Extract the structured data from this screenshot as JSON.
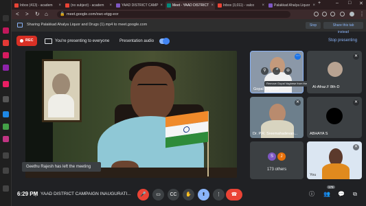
{
  "browser": {
    "tabs": [
      {
        "label": "Inbox (413) - academ",
        "fav_color": "#ea4335",
        "active": false
      },
      {
        "label": "(no subject) - academ",
        "fav_color": "#ea4335",
        "active": false
      },
      {
        "label": "YAAD DISTRICT CAMP",
        "fav_color": "#7e57c2",
        "active": false
      },
      {
        "label": "Meet - YAAD DISTRICT",
        "fav_color": "#00897b",
        "active": true
      },
      {
        "label": "Inbox (3,011) - valco",
        "fav_color": "#ea4335",
        "active": false
      },
      {
        "label": "Palakkad Ahalya Liquor",
        "fav_color": "#7e57c2",
        "active": false
      }
    ],
    "url": "meet.google.com/xwc-etgg-eor",
    "window_controls": [
      "–",
      "□",
      "✕"
    ]
  },
  "sharing_bar": {
    "text": "Sharing Palakkad Ahalya Liquor and Drugs (1).mp4 to meet.google.com",
    "stop_label": "Stop",
    "share_tab_label": "Share this tab instead"
  },
  "meet_header": {
    "rec_label": "REC",
    "presenting_text": "You're presenting to everyone",
    "audio_label": "Presentation audio",
    "audio_on": true,
    "stop_presenting_label": "Stop presenting"
  },
  "main_video": {
    "toast": "Geethu Rajesh has left the meeting"
  },
  "tiles": [
    {
      "name": "Gopal Vaghese",
      "tooltip": "Remove Gopal Vaghese from the call",
      "bg": "#8b98a8"
    },
    {
      "name": "Al-Afraz.F 8th-D",
      "bg": "#3c4043"
    },
    {
      "name": "Dr. P.R. Sreemahadevan...",
      "bg": "#6d7f8c"
    },
    {
      "name": "ABHAYA S",
      "bg": "#3c4043"
    },
    {
      "name": "173 others",
      "avatars": [
        "S",
        "J"
      ],
      "bg": "#3c4043"
    },
    {
      "name": "You",
      "bg": "#dbe6f2"
    }
  ],
  "bottom_bar": {
    "time": "6:29 PM",
    "separator": "|",
    "title": "YAAD DISTRICT CAMPAIGN INAUGURATI...",
    "participant_count": "179",
    "accent_red": "#ea4335",
    "accent_blue": "#8ab4f8"
  }
}
